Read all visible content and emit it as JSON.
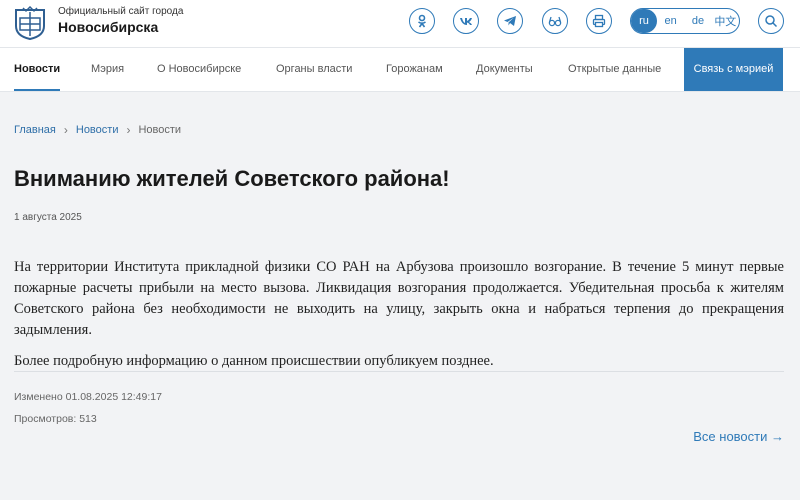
{
  "header": {
    "subtitle": "Официальный сайт города",
    "title": "Новосибирска",
    "icons": [
      "odnoklassniki-icon",
      "vk-icon",
      "telegram-icon",
      "accessibility-glasses-icon",
      "print-icon",
      "search-icon"
    ],
    "languages": [
      "ru",
      "en",
      "de",
      "中文"
    ],
    "active_language": "ru"
  },
  "nav": {
    "items": [
      "Новости",
      "Мэрия",
      "О Новосибирске",
      "Органы власти",
      "Горожанам",
      "Документы",
      "Открытые данные"
    ],
    "cta": "Связь с мэрией"
  },
  "breadcrumb": {
    "home": "Главная",
    "section": "Новости",
    "current": "Новости"
  },
  "article": {
    "title": "Вниманию жителей Советского района!",
    "date": "1 августа 2025",
    "paragraphs": [
      "На территории Института прикладной физики СО РАН на Арбузова произошло возгорание. В течение 5 минут первые пожарные расчеты прибыли на место вызова. Ликвидация возгорания продолжается. Убедительная просьба к жителям Советского района без необходимости не выходить на улицу, закрыть окна и набраться терпения до прекращения задымления.",
      "Более подробную информацию о данном происшествии опубликуем позднее."
    ],
    "modified": "Изменено 01.08.2025 12:49:17",
    "views": "Просмотров: 513",
    "all_news": "Все новости →"
  },
  "colors": {
    "accent": "#2f7ab8",
    "background": "#f2f3f5"
  }
}
